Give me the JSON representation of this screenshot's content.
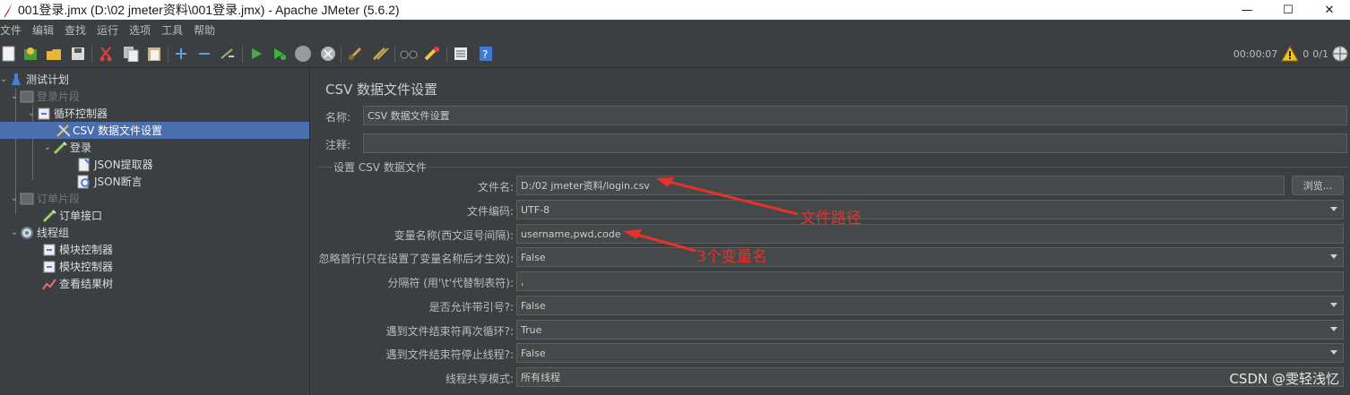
{
  "window": {
    "title": "001登录.jmx (D:\\02 jmeter资料\\001登录.jmx) - Apache JMeter (5.6.2)",
    "minimize": "—",
    "maximize": "☐",
    "close": "✕"
  },
  "menu": [
    "文件",
    "编辑",
    "查找",
    "运行",
    "选项",
    "工具",
    "帮助"
  ],
  "toolbar": {
    "timer": "00:00:07",
    "warnings": "0",
    "threads": "0/1"
  },
  "tree": {
    "items": [
      {
        "label": "测试计划",
        "icon": "flask-icon"
      },
      {
        "label": "登录片段",
        "icon": "fragment-icon",
        "disabled": true
      },
      {
        "label": "循环控制器",
        "icon": "loop-controller-icon"
      },
      {
        "label": "CSV 数据文件设置",
        "icon": "csv-config-icon",
        "selected": true
      },
      {
        "label": "登录",
        "icon": "sampler-icon"
      },
      {
        "label": "JSON提取器",
        "icon": "extractor-icon"
      },
      {
        "label": "JSON断言",
        "icon": "assertion-icon"
      },
      {
        "label": "订单片段",
        "icon": "fragment-icon",
        "disabled": true
      },
      {
        "label": "订单接口",
        "icon": "sampler-icon"
      },
      {
        "label": "线程组",
        "icon": "thread-group-icon"
      },
      {
        "label": "模块控制器",
        "icon": "module-controller-icon"
      },
      {
        "label": "模块控制器",
        "icon": "module-controller-icon"
      },
      {
        "label": "查看结果树",
        "icon": "listener-icon"
      }
    ]
  },
  "panel": {
    "title": "CSV 数据文件设置",
    "name_label": "名称:",
    "name_value": "CSV 数据文件设置",
    "comment_label": "注释:",
    "comment_value": "",
    "group_title": "设置 CSV 数据文件",
    "filename_label": "文件名:",
    "filename_value": "D:/02 jmeter资料/login.csv",
    "browse_label": "浏览...",
    "encoding_label": "文件编码:",
    "encoding_value": "UTF-8",
    "varnames_label": "变量名称(西文逗号间隔):",
    "varnames_value": "username,pwd,code",
    "ignore_first_label": "忽略首行(只在设置了变量名称后才生效):",
    "ignore_first_value": "False",
    "delimiter_label": "分隔符 (用'\\t'代替制表符):",
    "delimiter_value": ",",
    "quoted_label": "是否允许带引号?:",
    "quoted_value": "False",
    "recycle_label": "遇到文件结束符再次循环?:",
    "recycle_value": "True",
    "stop_label": "遇到文件结束符停止线程?:",
    "stop_value": "False",
    "sharing_label": "线程共享模式:",
    "sharing_value": "所有线程"
  },
  "annotations": {
    "file_path": "文件路径",
    "three_vars": "3个变量名"
  },
  "watermark": "CSDN @雯轻浅忆",
  "colors": {
    "background": "#3c3f41",
    "selection": "#4b6eaf",
    "annotation": "#e8302c"
  }
}
